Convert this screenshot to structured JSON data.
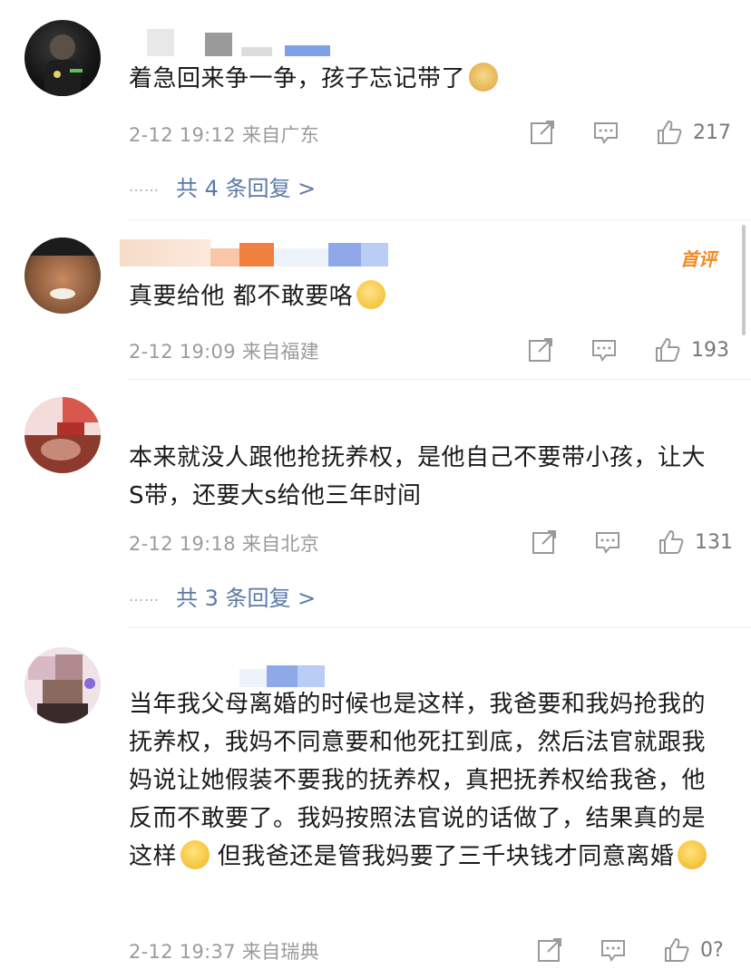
{
  "comments": [
    {
      "text": "着急回来争一争，孩子忘记带了",
      "emoji": "doge-emoji",
      "meta": "2-12 19:12  来自广东",
      "likes": "217",
      "replies": "共 4 条回复 >"
    },
    {
      "text": "真要给他 都不敢要咯",
      "emoji": "thinking-emoji",
      "meta": "2-12 19:09  来自福建",
      "likes": "193",
      "badge": "首评"
    },
    {
      "text": "本来就没人跟他抢抚养权，是他自己不要带小孩，让大S带，还要大s给他三年时间",
      "meta": "2-12 19:18  来自北京",
      "likes": "131",
      "replies": "共 3 条回复 >"
    },
    {
      "text": "当年我父母离婚的时候也是这样，我爸要和我妈抢我的抚养权，我妈不同意要和他死扛到底，然后法官就跟我妈说让她假装不要我的抚养权，真把抚养权给我爸，他反而不敢要了。我妈按照法官说的话做了，结果真的是这样",
      "text_tail": " 但我爸还是管我妈要了三千块钱才同意离婚",
      "meta": "2-12 19:37  来自瑞典",
      "likes": "0?"
    }
  ],
  "dots": "……",
  "colors": {
    "link": "#5b79a8",
    "meta": "#9b9b9b",
    "badge": "#f08a24"
  }
}
